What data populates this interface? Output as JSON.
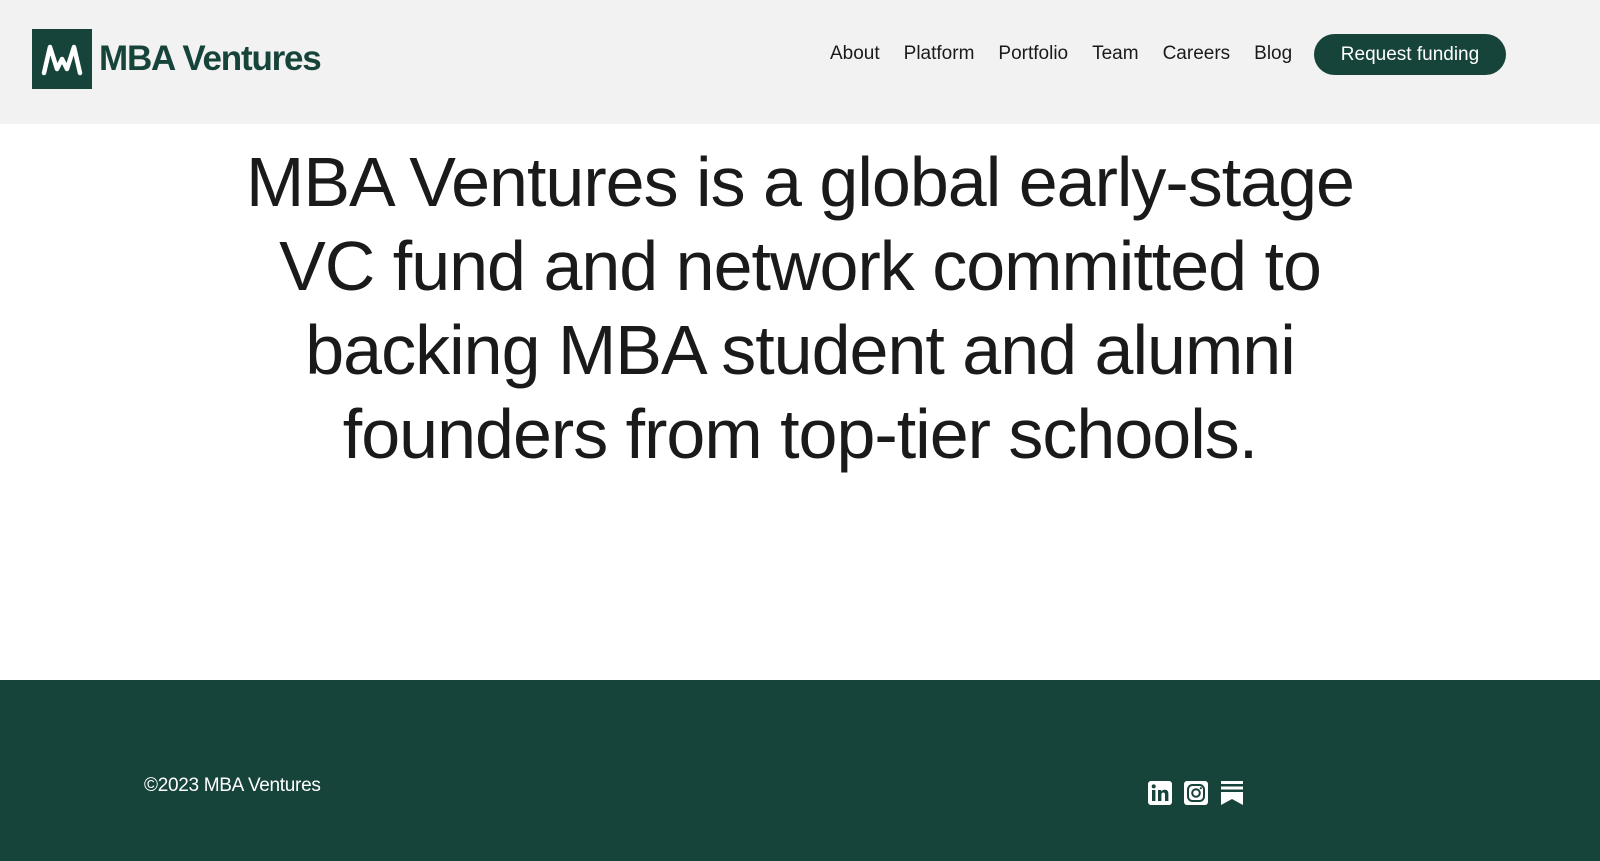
{
  "brand": {
    "name": "MBA Ventures",
    "logo_icon": "mba-m-pulse-icon",
    "color": "#17443a"
  },
  "nav": {
    "items": [
      {
        "label": "About"
      },
      {
        "label": "Platform"
      },
      {
        "label": "Portfolio"
      },
      {
        "label": "Team"
      },
      {
        "label": "Careers"
      },
      {
        "label": "Blog"
      }
    ],
    "cta_label": "Request funding"
  },
  "hero": {
    "lines": [
      "MBA Ventures is a global early-stage",
      "VC fund and network committed to",
      "backing MBA student and alumni",
      "founders from top-tier schools."
    ]
  },
  "footer": {
    "copyright": "©2023 MBA Ventures",
    "socials": [
      {
        "icon": "linkedin-icon"
      },
      {
        "icon": "instagram-icon"
      },
      {
        "icon": "substack-icon"
      }
    ],
    "background": "#17443a"
  }
}
